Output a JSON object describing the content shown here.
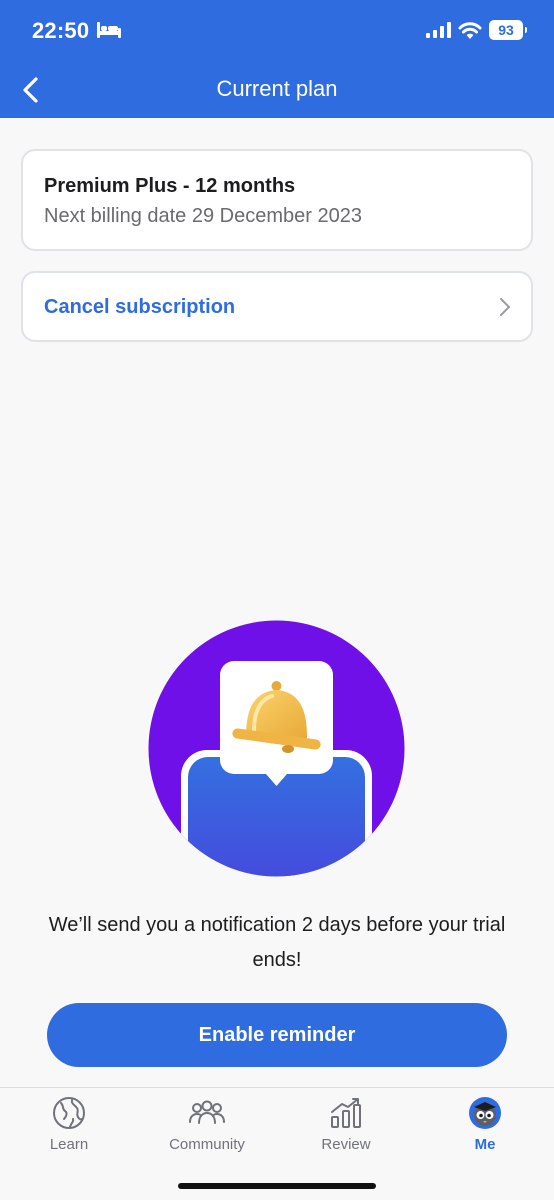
{
  "status_bar": {
    "time": "22:50",
    "battery": "93",
    "icons": [
      "bed-icon",
      "signal-icon",
      "wifi-icon",
      "battery-icon"
    ]
  },
  "header": {
    "title": "Current plan",
    "back_icon": "chevron-left-icon"
  },
  "plan": {
    "name": "Premium Plus - 12 months",
    "billing": "Next billing date 29 December 2023"
  },
  "cancel": {
    "label": "Cancel subscription",
    "icon": "chevron-right-icon"
  },
  "reminder": {
    "message": "We’ll send you a notification 2 days before your trial ends!",
    "button_label": "Enable reminder"
  },
  "tabs": [
    {
      "label": "Learn",
      "icon": "globe-icon",
      "active": false
    },
    {
      "label": "Community",
      "icon": "people-icon",
      "active": false
    },
    {
      "label": "Review",
      "icon": "bar-chart-icon",
      "active": false
    },
    {
      "label": "Me",
      "icon": "avatar-icon",
      "active": true
    }
  ],
  "colors": {
    "brand_blue": "#2f6ce0",
    "background": "#f8f8f9",
    "illustration_purple": "#6f10e8",
    "bell_yellow": "#f5c344"
  }
}
